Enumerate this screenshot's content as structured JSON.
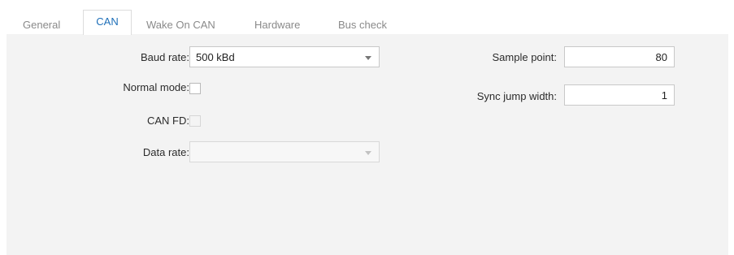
{
  "tabs": [
    "General",
    "CAN",
    "Wake On CAN",
    "Hardware",
    "Bus check"
  ],
  "active_tab": "CAN",
  "form": {
    "baud_rate_label": "Baud rate:",
    "baud_rate_value": "500 kBd",
    "normal_mode_label": "Normal mode:",
    "normal_mode_checked": false,
    "can_fd_label": "CAN FD:",
    "can_fd_checked": false,
    "data_rate_label": "Data rate:",
    "data_rate_value": "",
    "sample_point_label": "Sample point:",
    "sample_point_value": "80",
    "sync_jump_width_label": "Sync jump width:",
    "sync_jump_width_value": "1"
  },
  "colors": {
    "active_tab_text": "#1e6fb8",
    "inactive_tab_text": "#8a8a8a",
    "panel_background": "#f3f3f3"
  }
}
